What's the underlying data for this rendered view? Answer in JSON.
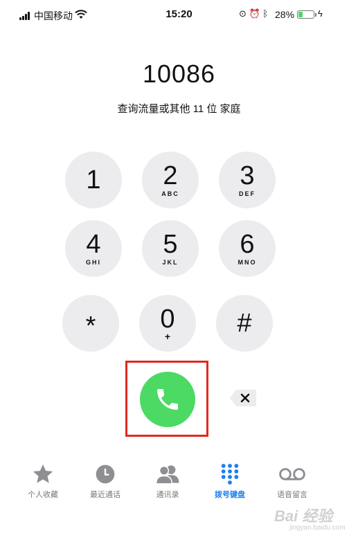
{
  "status_bar": {
    "carrier": "中国移动",
    "time": "15:20",
    "battery_percent": "28%",
    "battery_level": 0.28,
    "icons": [
      "signal-icon",
      "wifi-icon",
      "rotation-lock-icon",
      "alarm-icon",
      "bluetooth-icon",
      "battery-icon",
      "charging-icon"
    ]
  },
  "dialer": {
    "number": "10086",
    "label": "查询流量或其他 11 位 家庭"
  },
  "keypad": [
    {
      "digit": "1",
      "letters": ""
    },
    {
      "digit": "2",
      "letters": "ABC"
    },
    {
      "digit": "3",
      "letters": "DEF"
    },
    {
      "digit": "4",
      "letters": "GHI"
    },
    {
      "digit": "5",
      "letters": "JKL"
    },
    {
      "digit": "6",
      "letters": "MNO"
    },
    {
      "digit": "*",
      "letters": ""
    },
    {
      "digit": "0",
      "letters": "+"
    },
    {
      "digit": "#",
      "letters": ""
    }
  ],
  "call": {
    "button_color": "#4cd964",
    "highlight_color": "#e0281f"
  },
  "tabs": [
    {
      "label": "个人收藏",
      "icon": "star-icon",
      "active": false
    },
    {
      "label": "最近通话",
      "icon": "clock-icon",
      "active": false
    },
    {
      "label": "通讯录",
      "icon": "contacts-icon",
      "active": false
    },
    {
      "label": "拨号键盘",
      "icon": "keypad-icon",
      "active": true
    },
    {
      "label": "语音留言",
      "icon": "voicemail-icon",
      "active": false
    }
  ],
  "colors": {
    "accent": "#1e7ff0",
    "key_background": "#ececee",
    "inactive_tab": "#8e8e93"
  },
  "watermark": {
    "text": "Bai 经验",
    "sub": "jingyan.baidu.com"
  }
}
